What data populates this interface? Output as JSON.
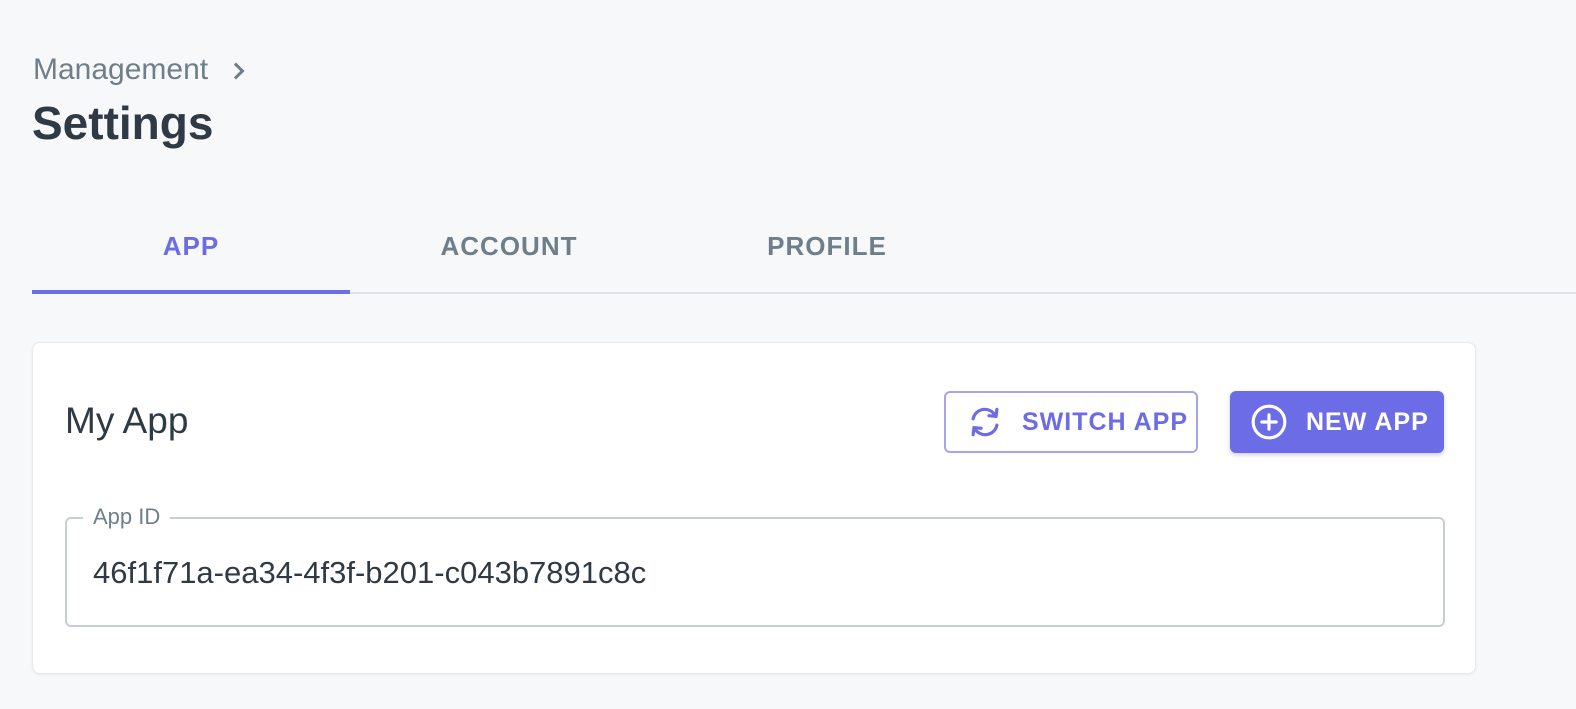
{
  "breadcrumb": {
    "parent": "Management"
  },
  "page_title": "Settings",
  "tabs": [
    {
      "label": "APP",
      "active": true
    },
    {
      "label": "ACCOUNT",
      "active": false
    },
    {
      "label": "PROFILE",
      "active": false
    }
  ],
  "card": {
    "title": "My App",
    "switch_app_label": "SWITCH APP",
    "switch_app_icon": "sync-icon",
    "new_app_label": "NEW APP",
    "new_app_icon": "plus-circle-icon",
    "app_id_label": "App ID",
    "app_id_value": "46f1f71a-ea34-4f3f-b201-c043b7891c8c"
  },
  "colors": {
    "accent": "#6c6ce6",
    "muted_text": "#6e7e8a",
    "background": "#f7f8fa"
  }
}
